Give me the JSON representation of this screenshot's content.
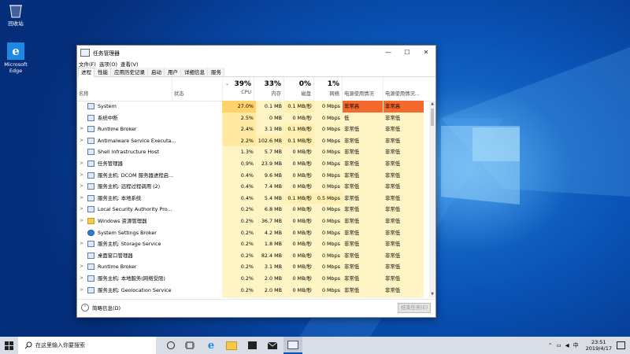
{
  "desktop": {
    "icons": [
      {
        "label": "回收站",
        "icon": "recycle-bin-icon"
      },
      {
        "label": "Microsoft Edge",
        "icon": "edge-icon"
      }
    ]
  },
  "window": {
    "title": "任务管理器",
    "menu": [
      "文件(F)",
      "选项(O)",
      "查看(V)"
    ],
    "tabs": [
      "进程",
      "性能",
      "应用历史记录",
      "启动",
      "用户",
      "详细信息",
      "服务"
    ],
    "active_tab": 0,
    "controls": {
      "minimize": "—",
      "maximize": "☐",
      "close": "✕"
    }
  },
  "header": {
    "name": "名称",
    "status": "状态",
    "cpu_pct": "39%",
    "cpu": "CPU",
    "mem_pct": "33%",
    "mem": "内存",
    "disk_pct": "0%",
    "disk": "磁盘",
    "net_pct": "1%",
    "net": "网络",
    "power": "电源使用情况",
    "power_trend": "电源使用情况..."
  },
  "rows": [
    {
      "exp": "",
      "name": "System",
      "cpu": "27.0%",
      "mem": "0.1 MB",
      "disk": "0.1 MB/秒",
      "net": "0 Mbps",
      "p1": "非常高",
      "p2": "非常高"
    },
    {
      "exp": "",
      "name": "系统中断",
      "cpu": "2.5%",
      "mem": "0 MB",
      "disk": "0 MB/秒",
      "net": "0 Mbps",
      "p1": "低",
      "p2": "非常低"
    },
    {
      "exp": ">",
      "name": "Runtime Broker",
      "cpu": "2.4%",
      "mem": "3.1 MB",
      "disk": "0.1 MB/秒",
      "net": "0 Mbps",
      "p1": "非常低",
      "p2": "非常低"
    },
    {
      "exp": ">",
      "name": "Antimalware Service Executa...",
      "cpu": "2.2%",
      "mem": "102.6 MB",
      "disk": "0.1 MB/秒",
      "net": "0 Mbps",
      "p1": "非常低",
      "p2": "非常低"
    },
    {
      "exp": "",
      "name": "Shell Infrastructure Host",
      "cpu": "1.3%",
      "mem": "5.7 MB",
      "disk": "0 MB/秒",
      "net": "0 Mbps",
      "p1": "非常低",
      "p2": "非常低"
    },
    {
      "exp": ">",
      "name": "任务管理器",
      "cpu": "0.9%",
      "mem": "23.9 MB",
      "disk": "0 MB/秒",
      "net": "0 Mbps",
      "p1": "非常低",
      "p2": "非常低"
    },
    {
      "exp": ">",
      "name": "服务主机: DCOM 服务器进程启...",
      "cpu": "0.4%",
      "mem": "9.6 MB",
      "disk": "0 MB/秒",
      "net": "0 Mbps",
      "p1": "非常低",
      "p2": "非常低"
    },
    {
      "exp": ">",
      "name": "服务主机: 远程过程调用 (2)",
      "cpu": "0.4%",
      "mem": "7.4 MB",
      "disk": "0 MB/秒",
      "net": "0 Mbps",
      "p1": "非常低",
      "p2": "非常低"
    },
    {
      "exp": ">",
      "name": "服务主机: 本地系统",
      "cpu": "0.4%",
      "mem": "5.4 MB",
      "disk": "0.1 MB/秒",
      "net": "0.5 Mbps",
      "p1": "非常低",
      "p2": "非常低"
    },
    {
      "exp": ">",
      "name": "Local Security Authority Pro...",
      "cpu": "0.2%",
      "mem": "6.8 MB",
      "disk": "0 MB/秒",
      "net": "0 Mbps",
      "p1": "非常低",
      "p2": "非常低"
    },
    {
      "exp": ">",
      "name": "Windows 资源管理器",
      "cpu": "0.2%",
      "mem": "36.7 MB",
      "disk": "0 MB/秒",
      "net": "0 Mbps",
      "p1": "非常低",
      "p2": "非常低"
    },
    {
      "exp": "",
      "name": "System Settings Broker",
      "cpu": "0.2%",
      "mem": "4.2 MB",
      "disk": "0 MB/秒",
      "net": "0 Mbps",
      "p1": "非常低",
      "p2": "非常低"
    },
    {
      "exp": ">",
      "name": "服务主机: Storage Service",
      "cpu": "0.2%",
      "mem": "1.8 MB",
      "disk": "0 MB/秒",
      "net": "0 Mbps",
      "p1": "非常低",
      "p2": "非常低"
    },
    {
      "exp": "",
      "name": "桌面窗口管理器",
      "cpu": "0.2%",
      "mem": "82.4 MB",
      "disk": "0 MB/秒",
      "net": "0 Mbps",
      "p1": "非常低",
      "p2": "非常低"
    },
    {
      "exp": ">",
      "name": "Runtime Broker",
      "cpu": "0.2%",
      "mem": "3.1 MB",
      "disk": "0 MB/秒",
      "net": "0 Mbps",
      "p1": "非常低",
      "p2": "非常低"
    },
    {
      "exp": ">",
      "name": "服务主机: 本地服务(网络受限)",
      "cpu": "0.2%",
      "mem": "2.0 MB",
      "disk": "0 MB/秒",
      "net": "0 Mbps",
      "p1": "非常低",
      "p2": "非常低"
    },
    {
      "exp": ">",
      "name": "服务主机: Geolocation Service",
      "cpu": "0.2%",
      "mem": "2.0 MB",
      "disk": "0 MB/秒",
      "net": "0 Mbps",
      "p1": "非常低",
      "p2": "非常低"
    }
  ],
  "footer": {
    "fewer_details": "简略信息(D)",
    "end_task": "结束任务(E)"
  },
  "taskbar": {
    "search_placeholder": "在这里输入你要搜索",
    "clock_time": "23:51",
    "clock_date": "2019/4/17",
    "ime": "中"
  },
  "colors": {
    "accent": "#0a54b8",
    "very_high": "#f5692c",
    "cpu_highlight": "#ffd36a",
    "cell_yellow": "#fff4c4"
  }
}
